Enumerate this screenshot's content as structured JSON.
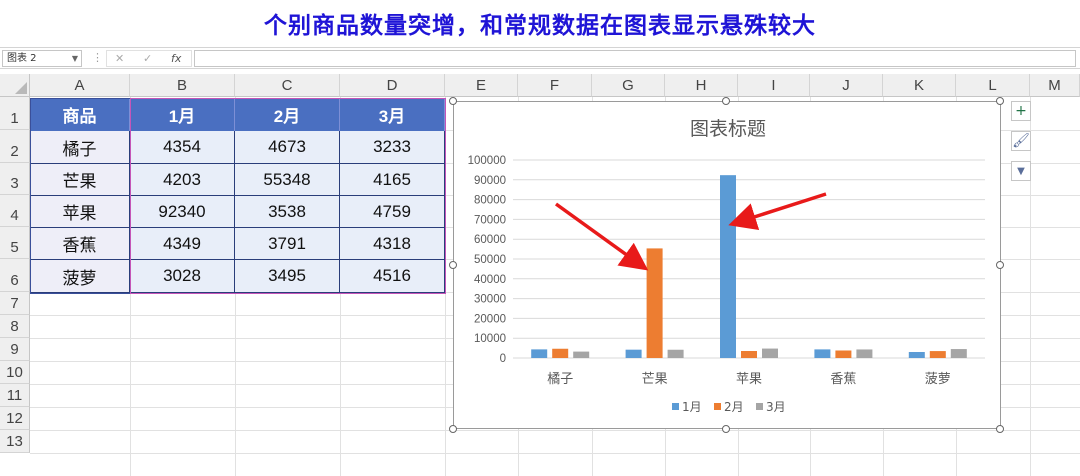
{
  "banner": {
    "title": "个别商品数量突增，和常规数据在图表显示悬殊较大"
  },
  "formula_bar": {
    "name_box": "图表 2",
    "cancel": "✕",
    "enter": "✓",
    "fx": "fx",
    "value": ""
  },
  "columns": [
    "A",
    "B",
    "C",
    "D",
    "E",
    "F",
    "G",
    "H",
    "I",
    "J",
    "K",
    "L",
    "M"
  ],
  "rows": [
    "1",
    "2",
    "3",
    "4",
    "5",
    "6",
    "7",
    "8",
    "9",
    "10",
    "11",
    "12",
    "13"
  ],
  "table": {
    "headers": [
      "商品",
      "1月",
      "2月",
      "3月"
    ],
    "rows": [
      [
        "橘子",
        "4354",
        "4673",
        "3233"
      ],
      [
        "芒果",
        "4203",
        "55348",
        "4165"
      ],
      [
        "苹果",
        "92340",
        "3538",
        "4759"
      ],
      [
        "香蕉",
        "4349",
        "3791",
        "4318"
      ],
      [
        "菠萝",
        "3028",
        "3495",
        "4516"
      ]
    ]
  },
  "chart_data": {
    "type": "bar",
    "title": "图表标题",
    "categories": [
      "橘子",
      "芒果",
      "苹果",
      "香蕉",
      "菠萝"
    ],
    "series": [
      {
        "name": "1月",
        "values": [
          4354,
          4203,
          92340,
          4349,
          3028
        ],
        "color": "#5b9bd5"
      },
      {
        "name": "2月",
        "values": [
          4673,
          55348,
          3538,
          3791,
          3495
        ],
        "color": "#ed7d31"
      },
      {
        "name": "3月",
        "values": [
          3233,
          4165,
          4759,
          4318,
          4516
        ],
        "color": "#a5a5a5"
      }
    ],
    "ylim": [
      0,
      100000
    ],
    "yticks": [
      "0",
      "10000",
      "20000",
      "30000",
      "40000",
      "50000",
      "60000",
      "70000",
      "80000",
      "90000",
      "100000"
    ],
    "grid": true,
    "legend": "bottom",
    "annotations": [
      {
        "type": "arrow",
        "color": "#e81a1a",
        "target": "芒果 2月"
      },
      {
        "type": "arrow",
        "color": "#e81a1a",
        "target": "苹果 1月"
      }
    ]
  },
  "chart_side_buttons": [
    {
      "icon": "plus-icon",
      "symbol": "+"
    },
    {
      "icon": "brush-icon",
      "symbol": "🖌"
    },
    {
      "icon": "filter-icon",
      "symbol": "▼"
    }
  ]
}
